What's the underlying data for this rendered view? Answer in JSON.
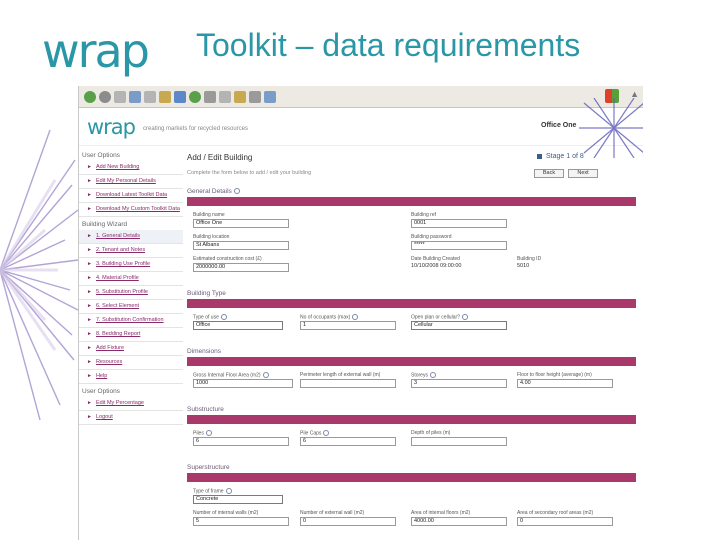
{
  "slide": {
    "title": "Toolkit – data requirements",
    "logo_text": "wrap"
  },
  "app": {
    "logo_text": "wrap",
    "tagline": "creating markets for recycled resources",
    "building_name": "Office One"
  },
  "sidebar": {
    "sections": [
      {
        "heading": "User Options",
        "items": [
          {
            "label": "Add New Building"
          },
          {
            "label": "Edit My Personal Details"
          },
          {
            "label": "Download Latest Toolkit Data"
          },
          {
            "label": "Download My Custom Toolkit Data"
          }
        ]
      },
      {
        "heading": "Building Wizard",
        "items": [
          {
            "label": "1. General Details",
            "active": true
          },
          {
            "label": "2. Tenant and Notes"
          },
          {
            "label": "3. Building Use Profile"
          },
          {
            "label": "4. Material Profile"
          },
          {
            "label": "5. Substitution Profile"
          },
          {
            "label": "6. Select Element"
          },
          {
            "label": "7. Substitution Confirmation"
          },
          {
            "label": "8. Bedding Report"
          },
          {
            "label": "Add Fixture"
          },
          {
            "label": "Resources"
          },
          {
            "label": "Help"
          }
        ]
      },
      {
        "heading": "User Options",
        "items": [
          {
            "label": "Edit My Percentage"
          },
          {
            "label": "Logout"
          }
        ]
      }
    ]
  },
  "main": {
    "title": "Add / Edit Building",
    "stage": "Stage 1 of 8",
    "instructions": "Complete the form below to add / edit your building",
    "back_label": "Back",
    "next_label": "Next",
    "sections": {
      "general": "General Details",
      "building_type": "Building Type",
      "dimensions": "Dimensions",
      "substructure": "Substructure",
      "superstructure": "Superstructure"
    },
    "general": {
      "building_name_label": "Building name",
      "building_name": "Office One",
      "building_ref_label": "Building ref",
      "building_ref": "0001",
      "building_location_label": "Building location",
      "building_location": "St Albans",
      "building_password_label": "Building password",
      "building_password": "*****",
      "project_value_label": "Estimated construction cost (£)",
      "project_value": "2000000.00",
      "date_created_label": "Date Building Created",
      "date_created": "10/10/2008 09:00:00",
      "building_id_label": "Building ID",
      "building_id": "5010"
    },
    "building_type": {
      "type_label": "Type of use",
      "type_value": "Office",
      "occupants_label": "No of occupants (max)",
      "occupants_value": "1",
      "open_plan_label": "Open plan or cellular?",
      "open_plan_value": "Cellular"
    },
    "dimensions": {
      "gifa_label": "Gross Internal Floor Area (m2)",
      "gifa_value": "1000",
      "perimeter_label": "Perimeter length of external wall (m)",
      "perimeter_value": "",
      "storeys_label": "Storeys",
      "storeys_value": "3",
      "floor_height_label": "Floor to floor height (average) (m)",
      "floor_height_value": "4.00"
    },
    "substructure": {
      "piles_label": "Piles",
      "piles_value": "6",
      "pile_caps_label": "Pile Caps",
      "pile_caps_value": "6",
      "pile_depth_label": "Depth of piles (m)",
      "pile_depth_value": ""
    },
    "superstructure": {
      "frame_label": "Type of frame",
      "frame_value": "Concrete",
      "int_walls_label": "Number of internal walls (m2)",
      "int_walls_value": "5",
      "ext_walls_label": "Number of external wall (m2)",
      "ext_walls_value": "0",
      "ext_floors_label": "Area of internal floors (m2)",
      "ext_floors_value": "4000.00",
      "roofs_label": "Area of secondary roof areas (m2)",
      "roofs_value": "0"
    }
  },
  "colors": {
    "accent": "#2a97a6",
    "section_bar": "#a8396a",
    "link": "#8a2a6a"
  }
}
